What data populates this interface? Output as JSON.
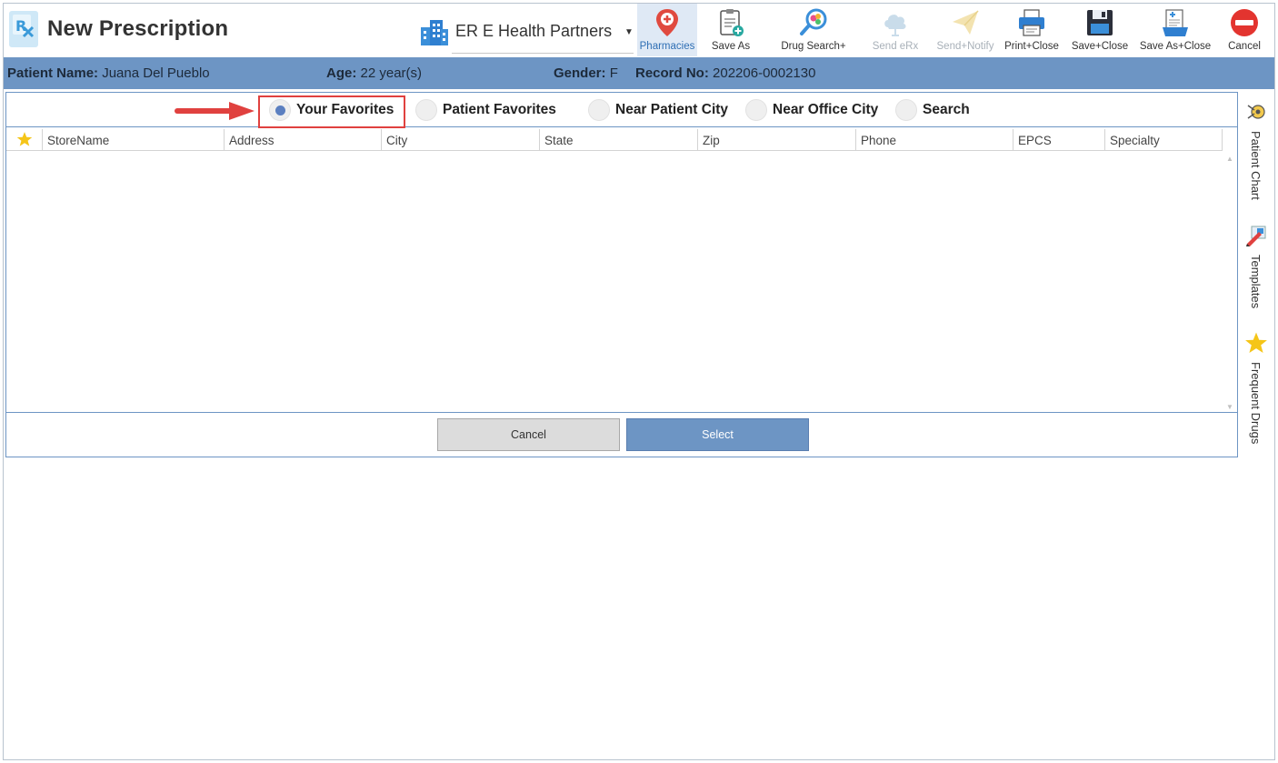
{
  "header": {
    "title": "New Prescription",
    "practice": "ER E Health Partners"
  },
  "toolbar": {
    "pharmacies": "Pharmacies",
    "save_as": "Save As",
    "drug_search": "Drug Search+",
    "send_erx": "Send eRx",
    "send_notify": "Send+Notify",
    "print_close": "Print+Close",
    "save_close": "Save+Close",
    "save_as_close": "Save As+Close",
    "cancel": "Cancel"
  },
  "patient": {
    "name_label": "Patient Name:",
    "name": "Juana Del Pueblo",
    "age_label": "Age:",
    "age": "22 year(s)",
    "gender_label": "Gender:",
    "gender": "F",
    "record_label": "Record No:",
    "record": "202206-0002130"
  },
  "radio_options": {
    "your_favorites": "Your Favorites",
    "patient_favorites": "Patient Favorites",
    "near_patient_city": "Near Patient City",
    "near_office_city": "Near Office City",
    "search": "Search",
    "selected": "Your Favorites"
  },
  "grid": {
    "columns": [
      "StoreName",
      "Address",
      "City",
      "State",
      "Zip",
      "Phone",
      "EPCS",
      "Specialty"
    ],
    "rows": []
  },
  "buttons": {
    "cancel": "Cancel",
    "select": "Select"
  },
  "side_tabs": {
    "patient_chart": "Patient Chart",
    "templates": "Templates",
    "frequent_drugs": "Frequent Drugs"
  },
  "colors": {
    "accent": "#6d95c4",
    "highlight": "#e0413f",
    "star": "#f5c518"
  }
}
